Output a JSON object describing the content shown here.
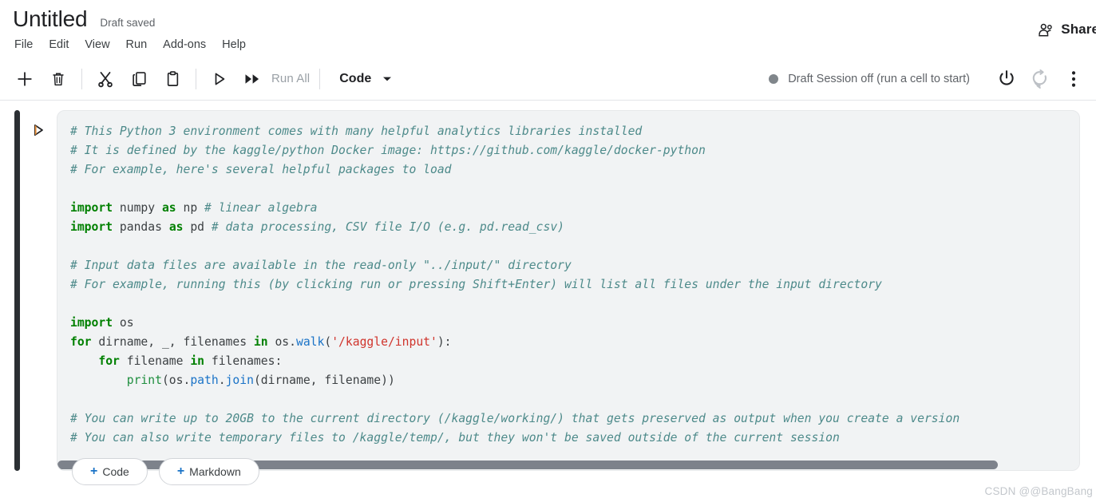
{
  "header": {
    "title": "Untitled",
    "save_status": "Draft saved",
    "share_label": "Share",
    "share_icon": "people-share-icon"
  },
  "menubar": {
    "items": [
      {
        "label": "File"
      },
      {
        "label": "Edit"
      },
      {
        "label": "View"
      },
      {
        "label": "Run"
      },
      {
        "label": "Add-ons"
      },
      {
        "label": "Help"
      }
    ]
  },
  "toolbar": {
    "buttons": [
      {
        "name": "add-cell-button",
        "icon": "plus-icon"
      },
      {
        "name": "delete-cell-button",
        "icon": "trash-icon"
      },
      {
        "name": "cut-cell-button",
        "icon": "scissors-icon"
      },
      {
        "name": "copy-cell-button",
        "icon": "copy-icon"
      },
      {
        "name": "paste-cell-button",
        "icon": "clipboard-icon"
      },
      {
        "name": "run-cell-button",
        "icon": "play-icon"
      }
    ],
    "run_all_label": "Run All",
    "run_all_icon": "fast-forward-icon",
    "cell_type": "Code",
    "cell_type_caret": "chevron-down-icon"
  },
  "session": {
    "status_text": "Draft Session off (run a cell to start)",
    "status_dot_color": "#80868b",
    "power_icon": "power-icon",
    "restart_icon": "restart-icon",
    "more_icon": "vertical-dots-icon"
  },
  "cell": {
    "run_icon": "play-triangle-icon",
    "scroll_thumb_percent": 92,
    "code_lines": [
      [
        {
          "t": "# This Python 3 environment comes with many helpful analytics libraries installed",
          "c": "cm"
        }
      ],
      [
        {
          "t": "# It is defined by the kaggle/python Docker image: https://github.com/kaggle/docker-python",
          "c": "cm"
        }
      ],
      [
        {
          "t": "# For example, here's several helpful packages to load",
          "c": "cm"
        }
      ],
      [
        {
          "t": "",
          "c": "pl"
        }
      ],
      [
        {
          "t": "import",
          "c": "kw"
        },
        {
          "t": " numpy ",
          "c": "pl"
        },
        {
          "t": "as",
          "c": "kw"
        },
        {
          "t": " np ",
          "c": "pl"
        },
        {
          "t": "# linear algebra",
          "c": "cm"
        }
      ],
      [
        {
          "t": "import",
          "c": "kw"
        },
        {
          "t": " pandas ",
          "c": "pl"
        },
        {
          "t": "as",
          "c": "kw"
        },
        {
          "t": " pd ",
          "c": "pl"
        },
        {
          "t": "# data processing, CSV file I/O (e.g. pd.read_csv)",
          "c": "cm"
        }
      ],
      [
        {
          "t": "",
          "c": "pl"
        }
      ],
      [
        {
          "t": "# Input data files are available in the read-only \"../input/\" directory",
          "c": "cm"
        }
      ],
      [
        {
          "t": "# For example, running this (by clicking run or pressing Shift+Enter) will list all files under the input directory",
          "c": "cm"
        }
      ],
      [
        {
          "t": "",
          "c": "pl"
        }
      ],
      [
        {
          "t": "import",
          "c": "kw"
        },
        {
          "t": " os",
          "c": "pl"
        }
      ],
      [
        {
          "t": "for",
          "c": "kw"
        },
        {
          "t": " dirname, _, filenames ",
          "c": "pl"
        },
        {
          "t": "in",
          "c": "kw"
        },
        {
          "t": " os.",
          "c": "pl"
        },
        {
          "t": "walk",
          "c": "fn"
        },
        {
          "t": "(",
          "c": "pl"
        },
        {
          "t": "'/kaggle/input'",
          "c": "st"
        },
        {
          "t": "):",
          "c": "pl"
        }
      ],
      [
        {
          "t": "    ",
          "c": "pl"
        },
        {
          "t": "for",
          "c": "kw"
        },
        {
          "t": " filename ",
          "c": "pl"
        },
        {
          "t": "in",
          "c": "kw"
        },
        {
          "t": " filenames:",
          "c": "pl"
        }
      ],
      [
        {
          "t": "        ",
          "c": "pl"
        },
        {
          "t": "print",
          "c": "gf"
        },
        {
          "t": "(os.",
          "c": "pl"
        },
        {
          "t": "path",
          "c": "fn"
        },
        {
          "t": ".",
          "c": "pl"
        },
        {
          "t": "join",
          "c": "fn"
        },
        {
          "t": "(dirname, filename))",
          "c": "pl"
        }
      ],
      [
        {
          "t": "",
          "c": "pl"
        }
      ],
      [
        {
          "t": "# You can write up to 20GB to the current directory (/kaggle/working/) that gets preserved as output when you create a version",
          "c": "cm"
        }
      ],
      [
        {
          "t": "# You can also write temporary files to /kaggle/temp/, but they won't be saved outside of the current session",
          "c": "cm"
        }
      ]
    ]
  },
  "add_cell": {
    "code_label": "Code",
    "markdown_label": "Markdown",
    "plus": "+"
  },
  "watermark": {
    "text": "CSDN @@BangBang"
  }
}
